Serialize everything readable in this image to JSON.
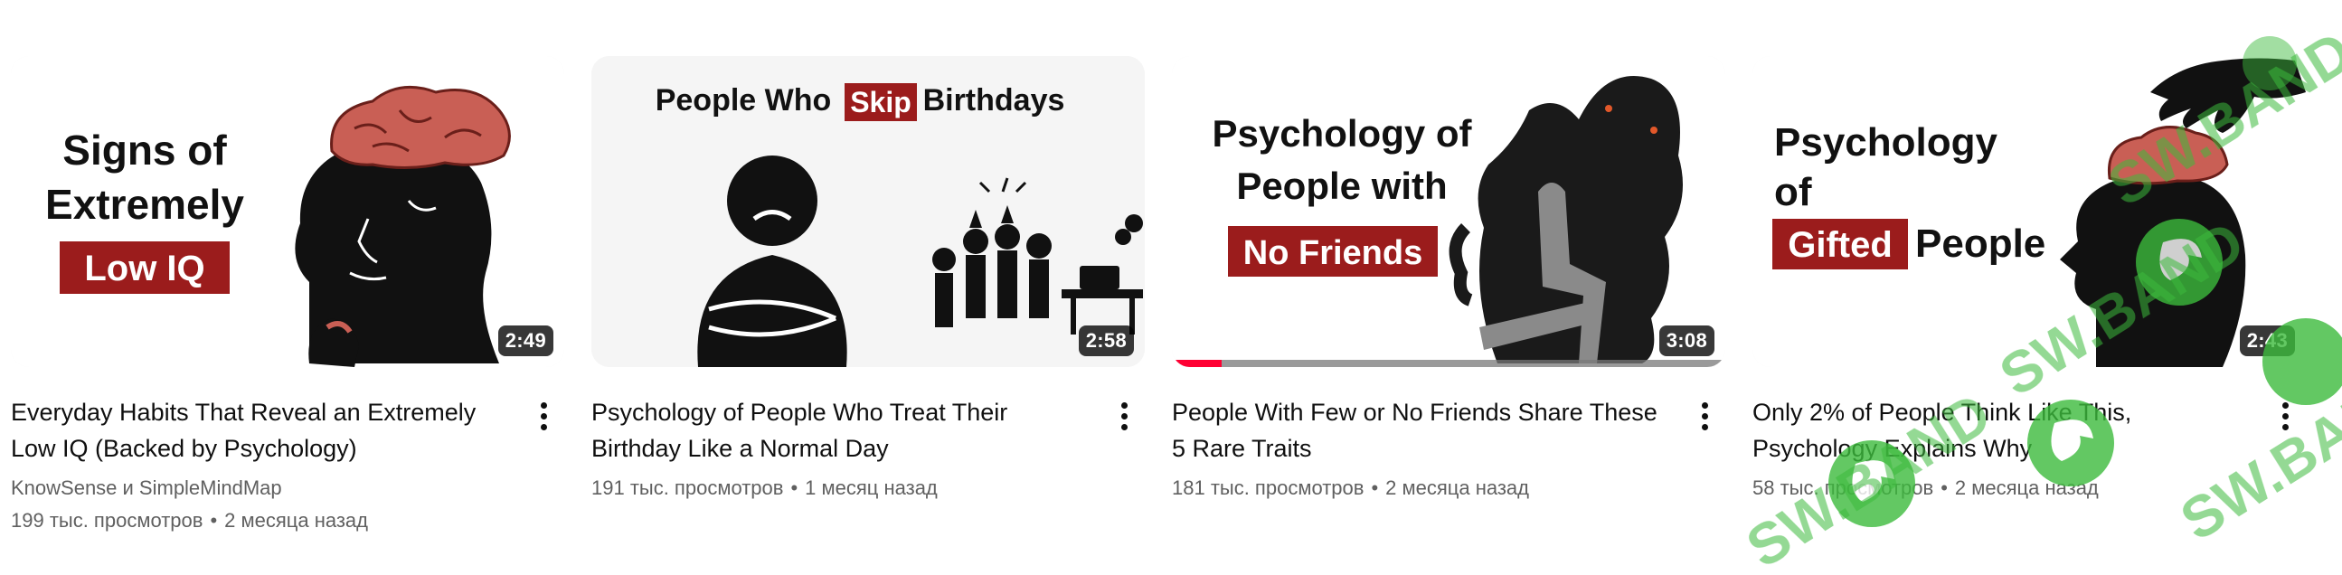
{
  "videos": [
    {
      "thumb_lines": [
        "Signs of",
        "Extremely",
        "Low IQ"
      ],
      "duration": "2:49",
      "title_line1": "Everyday Habits That Reveal an Extremely",
      "title_line2": "Low IQ (Backed by Psychology)",
      "channel": "KnowSense и SimpleMindMap",
      "views": "199 тыс. просмотров",
      "age": "2 месяца назад"
    },
    {
      "thumb_lines": [
        "People Who",
        "Skip",
        "Birthdays"
      ],
      "duration": "2:58",
      "title_line1": "Psychology of People Who Treat Their",
      "title_line2": "Birthday Like a Normal Day",
      "views": "191 тыс. просмотров",
      "age": "1 месяц назад"
    },
    {
      "thumb_lines": [
        "Psychology of",
        "People with",
        "No Friends"
      ],
      "duration": "3:08",
      "watch_progress": 0.09,
      "title_line1": "People With Few or No Friends Share These",
      "title_line2": "5 Rare Traits",
      "views": "181 тыс. просмотров",
      "age": "2 месяца назад"
    },
    {
      "thumb_lines": [
        "Psychology",
        "of",
        "Gifted",
        "People"
      ],
      "duration": "2:43",
      "title_line1": "Only 2% of People Think Like This,",
      "title_line2": "Psychology Explains Why",
      "views": "58 тыс. просмотров",
      "age": "2 месяца назад"
    }
  ],
  "separator": "•",
  "watermark_text": "SW.BAND",
  "colors": {
    "accent_red": "#9b1c1c",
    "progress_red": "#ff0033",
    "meta_gray": "#606060"
  }
}
